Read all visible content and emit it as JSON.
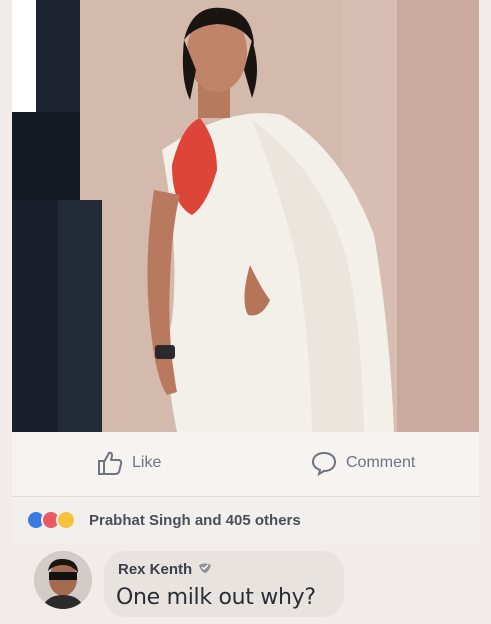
{
  "post": {
    "photo_alt": "Woman in white saree",
    "actions": {
      "like_label": "Like",
      "comment_label": "Comment"
    },
    "reactions": {
      "text": "Prabhat Singh and 405 others",
      "icons": [
        "like-reaction-icon",
        "love-reaction-icon",
        "haha-reaction-icon"
      ]
    },
    "comment": {
      "author": "Rex Kenth",
      "text": "One milk out why?"
    }
  },
  "colors": {
    "accent": "#3d7be4",
    "love": "#e95a61",
    "haha": "#f5c33b",
    "text_muted": "#6f7480"
  }
}
